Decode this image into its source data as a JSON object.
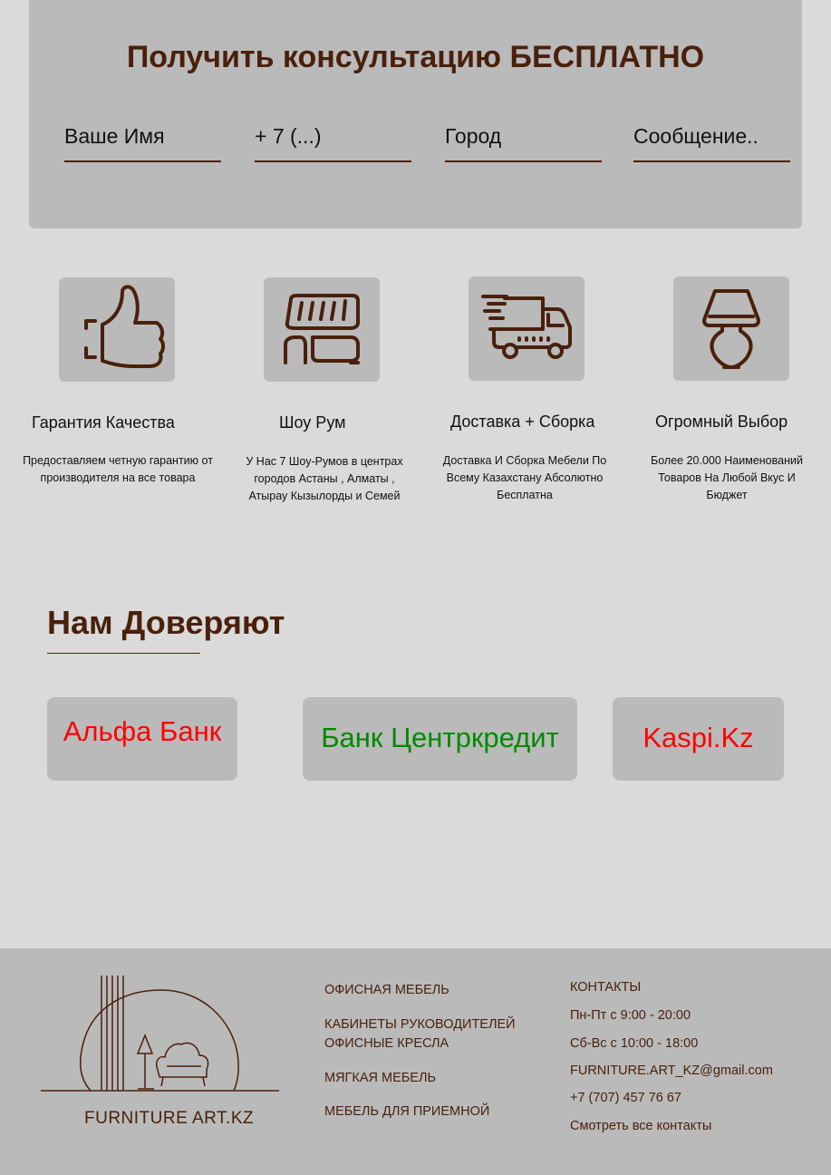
{
  "consultation": {
    "title": "Получить консультацию БЕСПЛАТНО",
    "fields": [
      {
        "placeholder": "Ваше Имя"
      },
      {
        "placeholder": "+ 7 (...)"
      },
      {
        "placeholder": "Город"
      },
      {
        "placeholder": "Сообщение.."
      }
    ]
  },
  "features": [
    {
      "icon": "thumbs-up-icon",
      "title": "Гарантия Качества",
      "description": "Предоставляем четную гарантию от производителя на все товара"
    },
    {
      "icon": "showroom-icon",
      "title": "Шоу Рум",
      "description": "У Нас 7 Шоу-Румов в центрах городов Астаны , Алматы , Атырау Кызылорды и Семей"
    },
    {
      "icon": "delivery-truck-icon",
      "title": "Доставка + Сборка",
      "description": "Доставка И Сборка Мебели По Всему Казахстану Абсолютно Бесплатна"
    },
    {
      "icon": "lamp-icon",
      "title": "Огромный Выбор",
      "description": "Более 20.000 Наименований Товаров На Любой Вкус И Бюджет"
    }
  ],
  "trust": {
    "title": "Нам Доверяют",
    "partners": [
      {
        "name": "Альфа Банк",
        "color": "#ff0000"
      },
      {
        "name": "Банк Центркредит",
        "color": "#008a00"
      },
      {
        "name": "Kaspi.Kz",
        "color": "#ff0000"
      }
    ]
  },
  "footer": {
    "logo_text": "FURNITURE ART.KZ",
    "nav": [
      {
        "label": "ОФИСНАЯ МЕБЕЛЬ"
      },
      {
        "label": "КАБИНЕТЫ РУКОВОДИТЕЛЕЙ"
      },
      {
        "label": "ОФИСНЫЕ КРЕСЛА"
      },
      {
        "label": "МЯГКАЯ МЕБЕЛЬ"
      },
      {
        "label": "МЕБЕЛЬ ДЛЯ ПРИЕМНОЙ"
      }
    ],
    "contacts": {
      "heading": "КОНТАКТЫ",
      "hours_weekdays": "Пн-Пт с 9:00 - 20:00",
      "hours_weekend": "Сб-Вс с 10:00 - 18:00",
      "email": "FURNITURE.ART_KZ@gmail.com",
      "phone": "+7 (707) 457 76 67",
      "all_link": "Смотреть все контакты"
    }
  },
  "colors": {
    "brown": "#4a200c",
    "panel": "#bababa",
    "background": "#dadada"
  }
}
